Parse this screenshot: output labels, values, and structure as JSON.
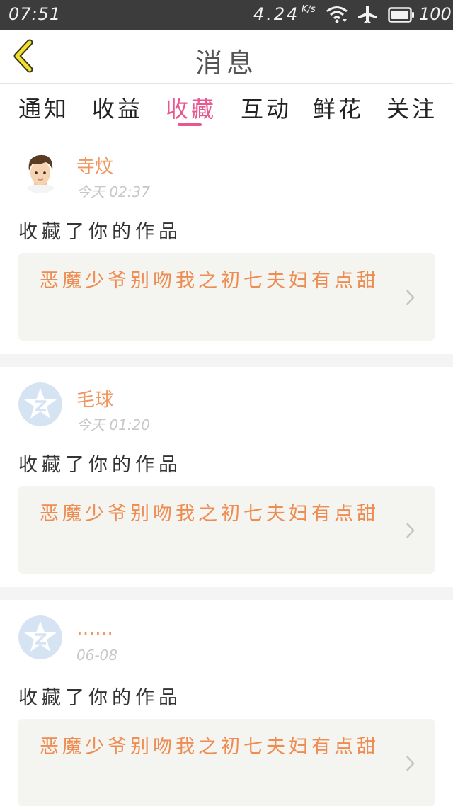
{
  "status_bar": {
    "time": "07:51",
    "net_speed": "4.24",
    "net_speed_unit": "K/s",
    "battery_level": "100",
    "wifi_icon": "wifi-icon",
    "plane_icon": "airplane-mode-icon",
    "battery_icon": "battery-icon"
  },
  "header": {
    "title": "消息",
    "back_icon": "chevron-left-icon"
  },
  "tabs": [
    {
      "label": "通知",
      "active": false
    },
    {
      "label": "收益",
      "active": false
    },
    {
      "label": "收藏",
      "active": true
    },
    {
      "label": "互动",
      "active": false
    },
    {
      "label": "鲜花",
      "active": false
    },
    {
      "label": "关注",
      "active": false
    }
  ],
  "colors": {
    "accent": "#e8578f",
    "username": "#f0965e",
    "work_title": "#ee8c52",
    "status_bar": "#3c3c3c",
    "default_avatar": "#d6e3f3"
  },
  "messages": [
    {
      "user": "寺炆",
      "time": "今天 02:37",
      "action": "收藏了你的作品",
      "work_title": "恶魔少爷别吻我之初七夫妇有点甜",
      "avatar": "user-photo-avatar"
    },
    {
      "user": "毛球",
      "time": "今天 01:20",
      "action": "收藏了你的作品",
      "work_title": "恶魔少爷别吻我之初七夫妇有点甜",
      "avatar": "default-qzone-avatar"
    },
    {
      "user": "……",
      "time": "06-08",
      "action": "收藏了你的作品",
      "work_title": "恶魔少爷别吻我之初七夫妇有点甜",
      "avatar": "default-qzone-avatar"
    }
  ]
}
